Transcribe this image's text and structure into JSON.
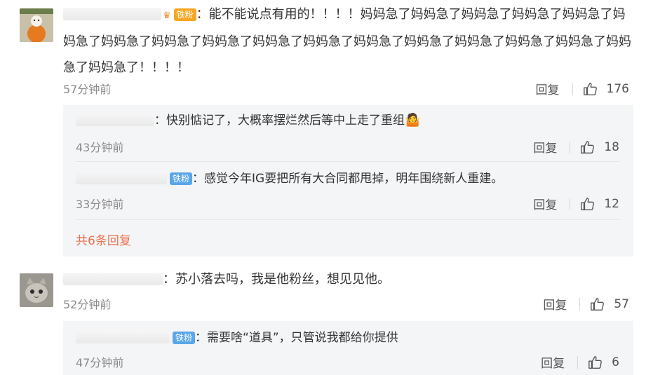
{
  "comments": [
    {
      "username": "",
      "badge": "铁粉",
      "text": "：能不能说点有用的！！！！妈妈急了妈妈急了妈妈急了妈妈急了妈妈急了妈妈急了妈妈急了妈妈急了妈妈急了妈妈急了妈妈急了妈妈急了妈妈急了妈妈急了妈妈急了妈妈急了妈妈急了妈妈急了！！！！",
      "time": "57分钟前",
      "reply_label": "回复",
      "likes": "176",
      "replies": [
        {
          "username": "",
          "text": "：快别惦记了，大概率摆烂然后等中上走了重组",
          "emoji": "🤷",
          "time": "43分钟前",
          "reply_label": "回复",
          "likes": "18"
        },
        {
          "username": "",
          "badge": "铁粉",
          "text": "：感觉今年IG要把所有大合同都甩掉，明年围绕新人重建。",
          "time": "33分钟前",
          "reply_label": "回复",
          "likes": "12"
        }
      ],
      "more_replies": "共6条回复"
    },
    {
      "username": "",
      "text": "：苏小落去吗，我是他粉丝，想见见他。",
      "time": "52分钟前",
      "reply_label": "回复",
      "likes": "57",
      "replies": [
        {
          "username": "",
          "badge": "铁粉",
          "text": "：需要啥“道具”，只管说我都给你提供",
          "time": "47分钟前",
          "reply_label": "回复",
          "likes": "6"
        }
      ]
    }
  ],
  "colors": {
    "accent_link": "#eb7350",
    "badge_gold": "#f6a623",
    "badge_blue": "#5aa6ea",
    "reply_bg": "#f4f5f7",
    "muted": "#8a8a8a"
  },
  "icons": {
    "like": "thumbs-up-icon",
    "crown": "crown-icon",
    "emoji": "shrug-emoji"
  }
}
